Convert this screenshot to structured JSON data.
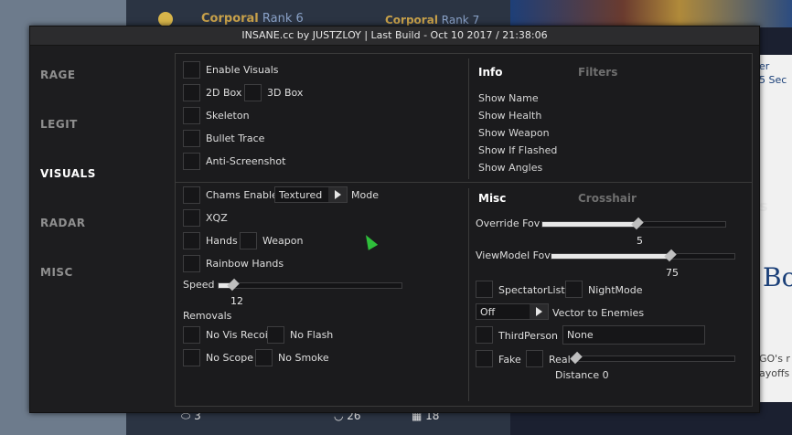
{
  "window": {
    "title": "INSANE.cc by JUSTZLOY | Last Build - Oct 10 2017 / 21:38:06"
  },
  "sidebar": {
    "items": [
      {
        "label": "RAGE",
        "active": false
      },
      {
        "label": "LEGIT",
        "active": false
      },
      {
        "label": "VISUALS",
        "active": true
      },
      {
        "label": "RADAR",
        "active": false
      },
      {
        "label": "MISC",
        "active": false
      }
    ]
  },
  "visuals": {
    "enable_visuals": "Enable Visuals",
    "box_2d": "2D Box",
    "box_3d": "3D Box",
    "skeleton": "Skeleton",
    "bullet_trace": "Bullet Trace",
    "anti_screenshot": "Anti-Screenshot"
  },
  "info_panel": {
    "tab_info": "Info",
    "tab_filters": "Filters",
    "items": [
      "Show Name",
      "Show Health",
      "Show Weapon",
      "Show If Flashed",
      "Show Angles"
    ]
  },
  "chams": {
    "enable": "Chams Enable",
    "mode_value": "Textured",
    "mode_label": "Mode",
    "xqz": "XQZ",
    "hands": "Hands",
    "weapon": "Weapon",
    "rainbow_hands": "Rainbow Hands",
    "speed_label": "Speed",
    "speed_value": "12",
    "speed_fraction": 0.08,
    "removals_label": "Removals",
    "no_vis_recoil": "No Vis Recoil",
    "no_flash": "No Flash",
    "no_scope": "No Scope",
    "no_smoke": "No Smoke"
  },
  "misc": {
    "tab_misc": "Misc",
    "tab_crosshair": "Crosshair",
    "override_fov_label": "Override Fov",
    "override_fov_value": "5",
    "override_fov_fraction": 0.52,
    "viewmodel_fov_label": "ViewModel Fov",
    "viewmodel_fov_value": "75",
    "viewmodel_fov_fraction": 0.65,
    "spectator_list": "SpectatorList",
    "night_mode": "NightMode",
    "vector_value": "Off",
    "vector_label": "Vector to Enemies",
    "third_person": "ThirdPerson",
    "third_person_value": "None",
    "fake": "Fake",
    "real": "Real",
    "distance_label": "Distance 0"
  },
  "background": {
    "rank_left_name": "Corporal",
    "rank_left_num": "Rank 6",
    "rank_right_name": "Corporal",
    "rank_right_num": "Rank 7",
    "right_text_1": "er",
    "right_text_2": "5 Sec",
    "right_text_3": "s",
    "right_big": "Bo",
    "right_text_4": "GO's r",
    "right_text_5": "ayoffs",
    "footer_1": "3",
    "footer_2": "26",
    "footer_3": "18"
  },
  "colors": {
    "window_bg": "#1d1d1f",
    "accent_active": "#ffffff",
    "inactive": "#8f8f8f",
    "cursor": "#2fbf3b"
  }
}
